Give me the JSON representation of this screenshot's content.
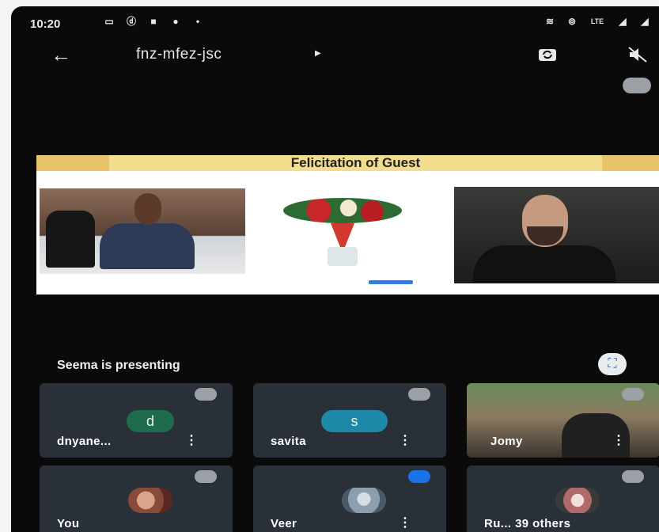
{
  "status_bar": {
    "time": "10:20",
    "network": "LTE"
  },
  "app_bar": {
    "meeting_code": "fnz-mfez-jsc"
  },
  "slide": {
    "title": "Felicitation of Guest"
  },
  "presenting_label": "Seema is presenting",
  "participants": [
    {
      "name": "dnyane...",
      "avatar_letter": "d",
      "avatar_color": "#1f6b4e"
    },
    {
      "name": "savita",
      "avatar_letter": "s",
      "avatar_color": "#1e88a8"
    },
    {
      "name": "Jomy"
    },
    {
      "name": "You"
    },
    {
      "name": "Veer"
    },
    {
      "name": "Ru... 39 others"
    }
  ],
  "colors": {
    "background": "#0a0a0a",
    "tile": "#2a3038",
    "accent": "#1a73e8",
    "slide_band": "#e7c46a"
  }
}
